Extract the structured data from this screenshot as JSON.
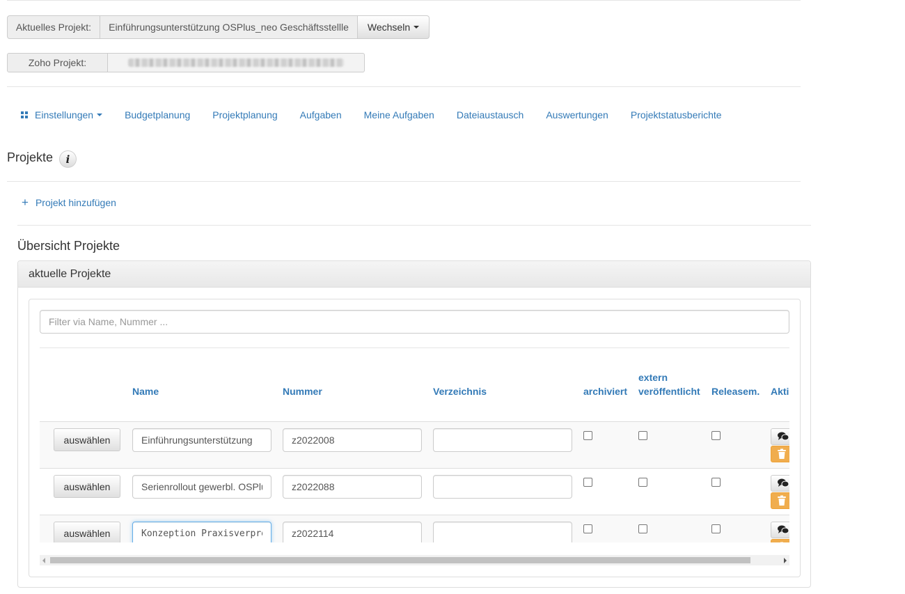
{
  "top": {
    "current_project_label": "Aktuelles Projekt:",
    "current_project_value": "Einführungsunterstützung OSPlus_neo Geschäftsstellle",
    "switch_button": "Wechseln",
    "zoho_label": "Zoho Projekt:"
  },
  "nav": {
    "items": [
      "Einstellungen",
      "Budgetplanung",
      "Projektplanung",
      "Aufgaben",
      "Meine Aufgaben",
      "Dateiaustausch",
      "Auswertungen",
      "Projektstatusberichte"
    ]
  },
  "page_title": "Projekte",
  "add_project": "Projekt hinzufügen",
  "overview_title": "Übersicht Projekte",
  "panel_title": "aktuelle Projekte",
  "filter_placeholder": "Filter via Name, Nummer ...",
  "table": {
    "headers": {
      "name": "Name",
      "nummer": "Nummer",
      "verzeichnis": "Verzeichnis",
      "archiviert": "archiviert",
      "extern_line1": "extern",
      "extern_line2": "veröffentlicht",
      "releasem": "Releasem.",
      "aktionen": "Aktionen"
    },
    "select_label": "auswählen",
    "rows": [
      {
        "name": "Einführungsunterstützung",
        "nummer": "z2022008",
        "verzeichnis": "",
        "archiviert": false,
        "extern": false,
        "releasem": false
      },
      {
        "name": "Serienrollout gewerbl. OSPlus",
        "nummer": "z2022088",
        "verzeichnis": "",
        "archiviert": false,
        "extern": false,
        "releasem": false
      },
      {
        "name": "Konzeption Praxisverprobung",
        "nummer": "z2022114",
        "verzeichnis": "",
        "archiviert": false,
        "extern": false,
        "releasem": false
      }
    ]
  },
  "colors": {
    "link": "#337ab7",
    "warning": "#f0ad4e",
    "focus": "#66afe9"
  }
}
